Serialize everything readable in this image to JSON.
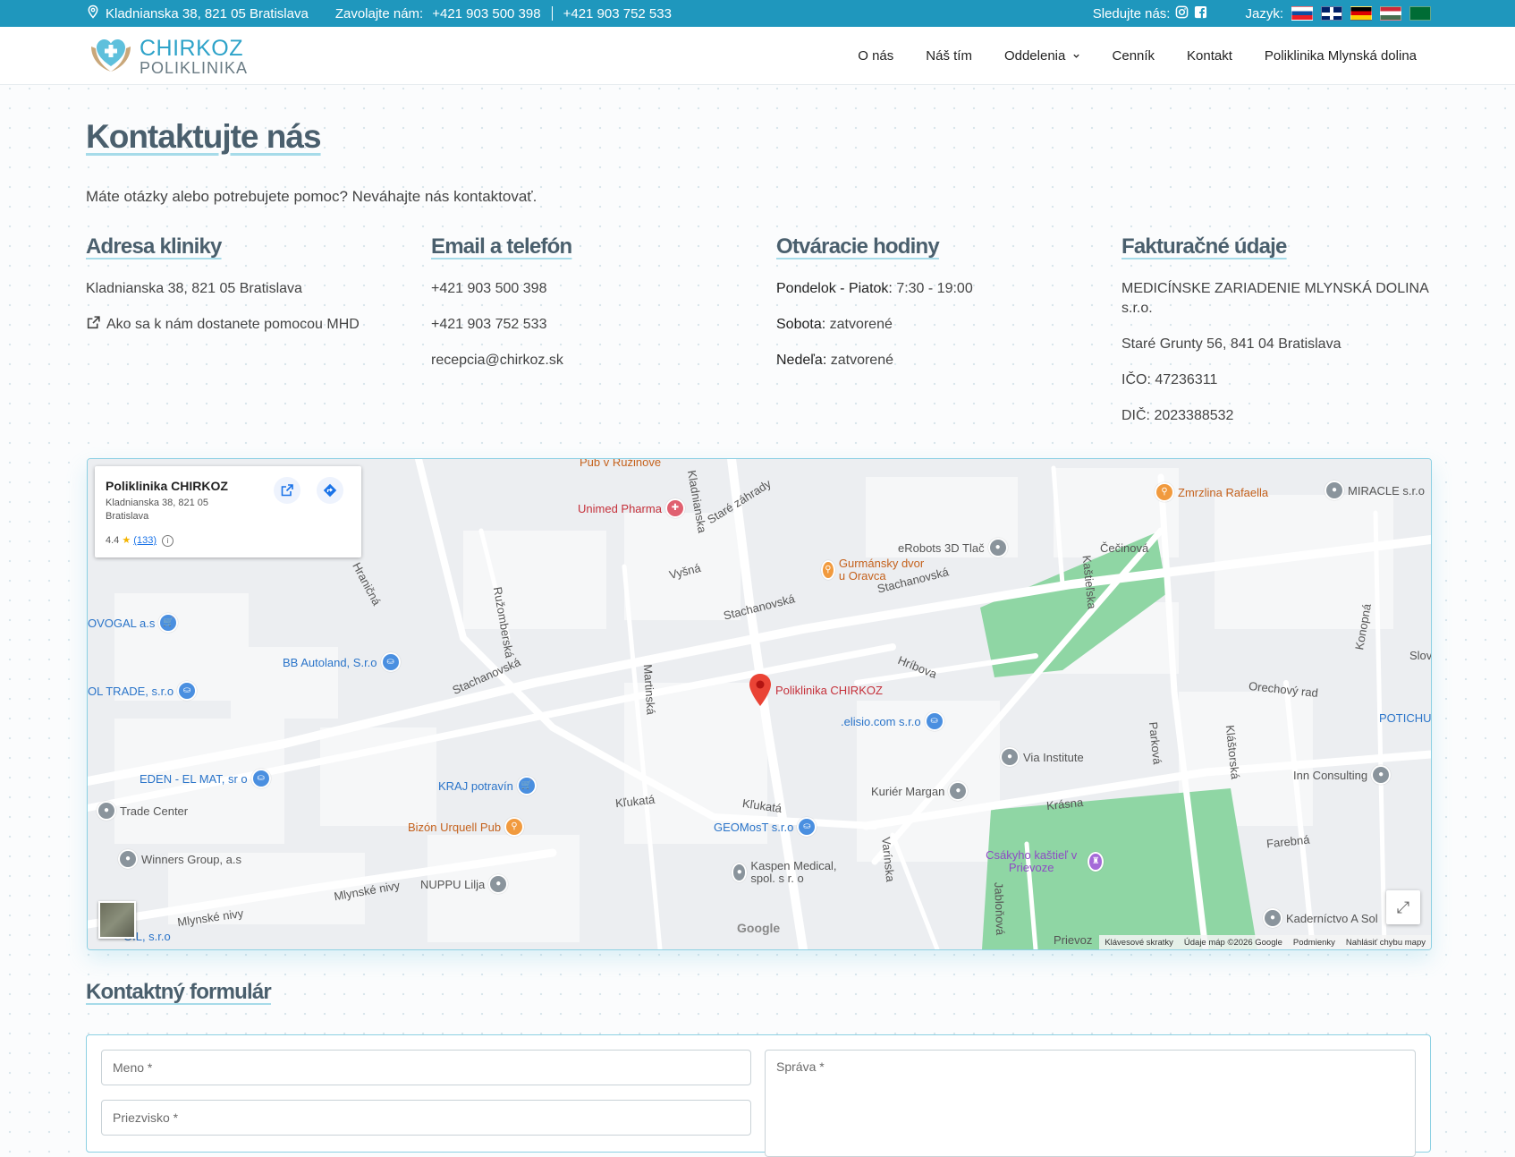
{
  "topbar": {
    "address": "Kladnianska 38, 821 05 Bratislava",
    "call_label": "Zavolajte nám:",
    "phone1": "+421 903 500 398",
    "phone2": "+421 903 752 533",
    "follow_label": "Sledujte nás:",
    "lang_label": "Jazyk:",
    "languages": [
      "sk",
      "en",
      "de",
      "hu",
      "ar"
    ]
  },
  "logo": {
    "line1": "CHIRKOZ",
    "line2": "POLIKLINIKA"
  },
  "nav": {
    "items": [
      "O nás",
      "Náš tím",
      "Oddelenia",
      "Cenník",
      "Kontakt",
      "Poliklinika Mlynská dolina"
    ]
  },
  "page": {
    "title": "Kontaktujte nás",
    "intro": "Máte otázky alebo potrebujete pomoc? Neváhajte nás kontaktovať."
  },
  "address": {
    "heading": "Adresa kliniky",
    "line": "Kladnianska 38, 821 05 Bratislava",
    "mhd_link": "Ako sa k nám dostanete pomocou MHD"
  },
  "contact": {
    "heading": "Email a telefón",
    "phone1": "+421 903 500 398",
    "phone2": "+421 903 752 533",
    "email": "recepcia@chirkoz.sk"
  },
  "hours": {
    "heading": "Otváracie hodiny",
    "weekdays_label": "Pondelok - Piatok:",
    "weekdays_value": "7:30 - 19:00",
    "saturday_label": "Sobota:",
    "saturday_value": "zatvorené",
    "sunday_label": "Nedeľa:",
    "sunday_value": "zatvorené"
  },
  "billing": {
    "heading": "Fakturačné údaje",
    "company": "MEDICÍNSKE ZARIADENIE MLYNSKÁ DOLINA s.r.o.",
    "address": "Staré Grunty 56, 841 04 Bratislava",
    "ico": "IČO: 47236311",
    "dic": "DIČ: 2023388532"
  },
  "map": {
    "card_name": "Poliklinika CHIRKOZ",
    "card_address": "Kladnianska 38, 821 05 Bratislava",
    "card_rating": "4.4",
    "card_reviews": "(133)",
    "marker_label": "Poliklinika CHIRKOZ",
    "streets": [
      "Kladnianska",
      "Staré záhrady",
      "Vyšná",
      "Hraničná",
      "Stachanovská",
      "Ružomberská",
      "Kľukatá",
      "Martinská",
      "Hríbova",
      "Kaštieľska",
      "Čečinová",
      "Orechový rad",
      "Kláštorská",
      "Parková",
      "Krásna",
      "Farebná",
      "Konopná",
      "Mlynské nivy",
      "Varínska",
      "Jabloňová",
      "Prievoz",
      "Slov",
      "Kaštie¾ska"
    ],
    "pois": [
      "Pub v Ružinove",
      "Unimed Pharma",
      "Zmrzlina Rafaella",
      "MIRACLE s.r.o",
      "eRobots 3D Tlač",
      "Gurmánsky dvor u Oravca",
      "OVOGAL a.s",
      "BB Autoland, S.r.o",
      "OL TRADE, s.r.o",
      ".elisio.com s.r.o",
      "EDEN - EL MAT, sr o",
      "KRAJ potravín",
      "Trade Center",
      "Bizón Urquell Pub",
      "Winners Group, a.s",
      "NUPPU Lilja",
      "GEOMosT s.r.o",
      "Kaspen Medical, spol. s r. o",
      "Kuriér Margan",
      "Via Institute",
      "Csákyho kaštieľ v Prievoze",
      "Inn Consulting",
      "POTICHU",
      "Kaderníctvo A Sol",
      "OIL, s.r.o"
    ],
    "footer": [
      "Klávesové skratky",
      "Údaje máp ©2026 Google",
      "Podmienky",
      "Nahlásiť chybu mapy"
    ],
    "google": "Google"
  },
  "form": {
    "heading": "Kontaktný formulár",
    "first_name_placeholder": "Meno *",
    "last_name_placeholder": "Priezvisko *",
    "message_placeholder": "Správa *"
  }
}
